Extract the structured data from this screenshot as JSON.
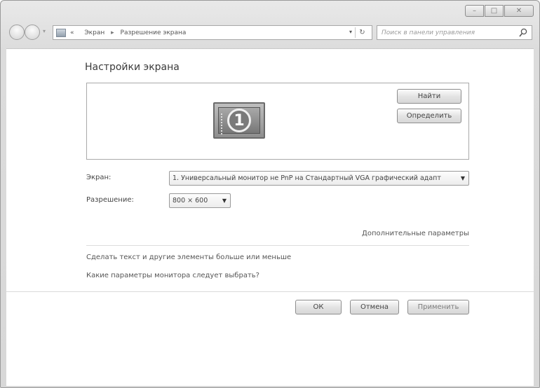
{
  "window": {
    "address": {
      "breadcrumb_prefix": "«",
      "crumb1": "Экран",
      "separator": "▸",
      "crumb2": "Разрешение экрана",
      "dropdown": "▾",
      "refresh": "↻"
    },
    "search": {
      "placeholder": "Поиск в панели управления"
    },
    "controls": {
      "minimize": "–",
      "maximize": "□",
      "close": "✕"
    }
  },
  "content": {
    "title": "Настройки экрана",
    "monitor_number": "1",
    "buttons": {
      "find": "Найти",
      "identify": "Определить"
    },
    "screen": {
      "label": "Экран:",
      "value": "1. Универсальный монитор не PnP на Стандартный VGA графический адапт"
    },
    "resolution": {
      "label": "Разрешение:",
      "value": "800 × 600"
    },
    "links": {
      "advanced": "Дополнительные параметры",
      "text_size": "Сделать текст и другие элементы больше или меньше",
      "which_monitor": "Какие параметры монитора следует выбрать?"
    },
    "footer": {
      "ok": "ОК",
      "cancel": "Отмена",
      "apply": "Применить"
    }
  }
}
